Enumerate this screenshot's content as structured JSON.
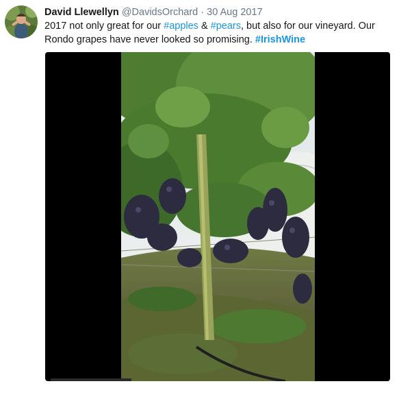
{
  "author": {
    "name": "David Llewellyn",
    "handle": "@DavidsOrchard",
    "separator": "·",
    "date": "30 Aug 2017",
    "avatar_icon": "profile-photo"
  },
  "tweet": {
    "text_parts": {
      "p1": "2017 not only great for our ",
      "tag1": "#apples",
      "p2": " & ",
      "tag2": "#pears",
      "p3": ", but also for our vineyard. Our Rondo grapes have never looked so promising. ",
      "tag3": "#IrishWine"
    }
  },
  "media": {
    "type": "video",
    "subject": "vineyard-grapevine"
  },
  "colors": {
    "link": "#1b95e0",
    "text": "#14171a",
    "secondary": "#657786",
    "media_background": "#000000"
  }
}
